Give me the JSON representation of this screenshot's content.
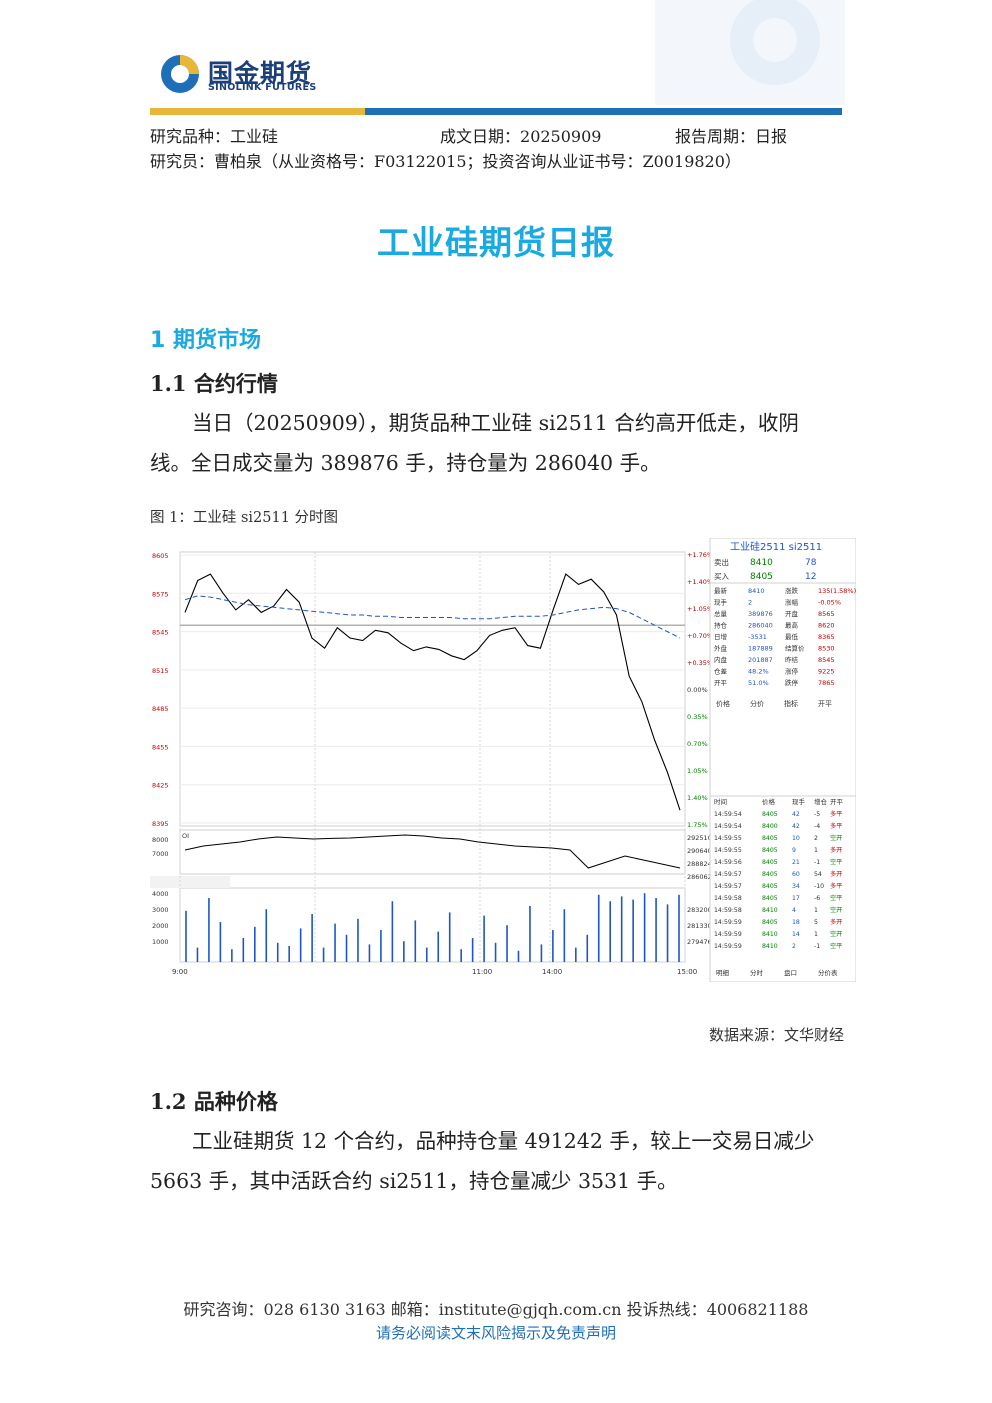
{
  "logo": {
    "cn": "国金期货",
    "en": "SINOLINK FUTURES"
  },
  "meta": {
    "variety_label": "研究品种：",
    "variety": "工业硅",
    "date_label": "成文日期：",
    "date": "20250909",
    "period_label": "报告周期：",
    "period": "日报",
    "researcher": "研究员：曹柏泉（从业资格号：F03122015；投资咨询从业证书号：Z0019820）"
  },
  "title": "工业硅期货日报",
  "section1": "1 期货市场",
  "sub1": "1.1 合约行情",
  "para1": "当日（20250909），期货品种工业硅 si2511 合约高开低走，收阴线。全日成交量为 389876 手，持仓量为 286040 手。",
  "figure_caption": "图 1：工业硅 si2511 分时图",
  "source": "数据来源：文华财经",
  "sub2": "1.2 品种价格",
  "para2": "工业硅期货 12 个合约，品种持仓量 491242 手，较上一交易日减少 5663 手，其中活跃合约 si2511，持仓量减少 3531 手。",
  "footer": {
    "contact": "研究咨询：028 6130 3163  邮箱：institute@gjqh.com.cn  投诉热线：4006821188",
    "disclaimer": "请务必阅读文末风险揭示及免责声明"
  },
  "colors": {
    "brand_blue": "#1f6fb8",
    "title_blue": "#1aa9e0",
    "gold": "#e8b73a"
  },
  "chart_data": {
    "type": "line",
    "title": "工业硅2511 si2511",
    "price_ticks_left": [
      "8605",
      "8575",
      "8545",
      "8515",
      "8485",
      "8455",
      "8425",
      "8395"
    ],
    "pct_ticks_right": [
      "+1.76%",
      "+1.40%",
      "+1.05%",
      "+0.70%",
      "+0.35%",
      "0.00%",
      "0.35%",
      "0.70%",
      "1.05%",
      "1.40%",
      "1.75%"
    ],
    "time_ticks": [
      "9:00",
      "",
      "11:00",
      "14:00",
      "15:00"
    ],
    "oi_ticks_left": [
      "8000",
      "7000"
    ],
    "oi_ticks_right": [
      "292510",
      "290640",
      "288824",
      "286062"
    ],
    "vol_ticks_left": [
      "4000",
      "3000",
      "2000",
      "1000"
    ],
    "vol_ticks_right": [
      "283200",
      "281330",
      "279476"
    ],
    "prev_settle": 8550,
    "price_series": [
      8560,
      8585,
      8590,
      8575,
      8562,
      8570,
      8560,
      8565,
      8578,
      8568,
      8540,
      8532,
      8548,
      8540,
      8538,
      8546,
      8544,
      8536,
      8530,
      8533,
      8531,
      8526,
      8523,
      8530,
      8542,
      8546,
      8548,
      8534,
      8532,
      8562,
      8590,
      8582,
      8586,
      8576,
      8558,
      8510,
      8490,
      8460,
      8435,
      8405
    ],
    "avg_series": [
      8570,
      8573,
      8572,
      8570,
      8568,
      8566,
      8565,
      8564,
      8563,
      8562,
      8561,
      8560,
      8559,
      8558,
      8558,
      8557,
      8557,
      8556,
      8556,
      8556,
      8556,
      8556,
      8555,
      8555,
      8555,
      8556,
      8557,
      8557,
      8557,
      8558,
      8560,
      8562,
      8563,
      8564,
      8563,
      8560,
      8555,
      8550,
      8545,
      8540
    ],
    "quote": {
      "sell_label": "卖出",
      "sell_price": "8410",
      "sell_qty": "78",
      "buy_label": "买入",
      "buy_price": "8405",
      "buy_qty": "12",
      "rows": [
        [
          "最新",
          "8410",
          "涨跌",
          "135(1.58%)"
        ],
        [
          "现手",
          "2",
          "涨幅",
          "-0.05%"
        ],
        [
          "总量",
          "389876",
          "开盘",
          "8565"
        ],
        [
          "持仓",
          "286040",
          "最高",
          "8620"
        ],
        [
          "日增",
          "-3531",
          "最低",
          "8365"
        ],
        [
          "外盘",
          "187889",
          "结算价",
          "8530"
        ],
        [
          "内盘",
          "201887",
          "昨结",
          "8545"
        ],
        [
          "仓差",
          "48.2%",
          "涨停",
          "9225"
        ],
        [
          "开平",
          "51.0%",
          "跌停",
          "7865"
        ]
      ],
      "tabs": [
        "价格",
        "分价",
        "指标",
        "开平"
      ],
      "ticks_header": [
        "时间",
        "价格",
        "现手",
        "增仓",
        "开平"
      ],
      "ticks": [
        [
          "14:59:54",
          "8405",
          "42",
          "-5",
          "多平"
        ],
        [
          "14:59:54",
          "8400",
          "42",
          "-4",
          "多平"
        ],
        [
          "14:59:55",
          "8405",
          "10",
          "2",
          "空开"
        ],
        [
          "14:59:55",
          "8405",
          "9",
          "1",
          "多开"
        ],
        [
          "14:59:56",
          "8405",
          "21",
          "-1",
          "空平"
        ],
        [
          "14:59:57",
          "8405",
          "60",
          "54",
          "多开"
        ],
        [
          "14:59:57",
          "8405",
          "34",
          "-10",
          "多平"
        ],
        [
          "14:59:58",
          "8405",
          "17",
          "-6",
          "空平"
        ],
        [
          "14:59:58",
          "8410",
          "4",
          "1",
          "空开"
        ],
        [
          "14:59:59",
          "8405",
          "18",
          "5",
          "多开"
        ],
        [
          "14:59:59",
          "8410",
          "14",
          "1",
          "空开"
        ],
        [
          "14:59:59",
          "8410",
          "2",
          "-1",
          "空平"
        ]
      ],
      "bottom_tabs": [
        "明细",
        "分时",
        "盘口",
        "分价表"
      ]
    },
    "oi_series": [
      7400,
      7600,
      7700,
      7800,
      7950,
      8050,
      8000,
      7950,
      7980,
      8000,
      8050,
      8100,
      8150,
      8100,
      8000,
      7950,
      7800,
      7700,
      7600,
      7550,
      7500,
      7400,
      6500,
      6800,
      7100,
      6900,
      6700,
      6500
    ],
    "volume_series": [
      3200,
      900,
      4000,
      2500,
      800,
      1500,
      2200,
      3300,
      1200,
      1000,
      2100,
      3000,
      900,
      2400,
      1700,
      2700,
      1100,
      2000,
      3800,
      1300,
      2600,
      900,
      1900,
      3100,
      800,
      1500,
      2900,
      1200,
      2300,
      700,
      3500,
      1100,
      2000,
      3300,
      900,
      1700,
      4200,
      3800,
      4100,
      3900,
      4300,
      4000,
      3600,
      4200
    ]
  }
}
